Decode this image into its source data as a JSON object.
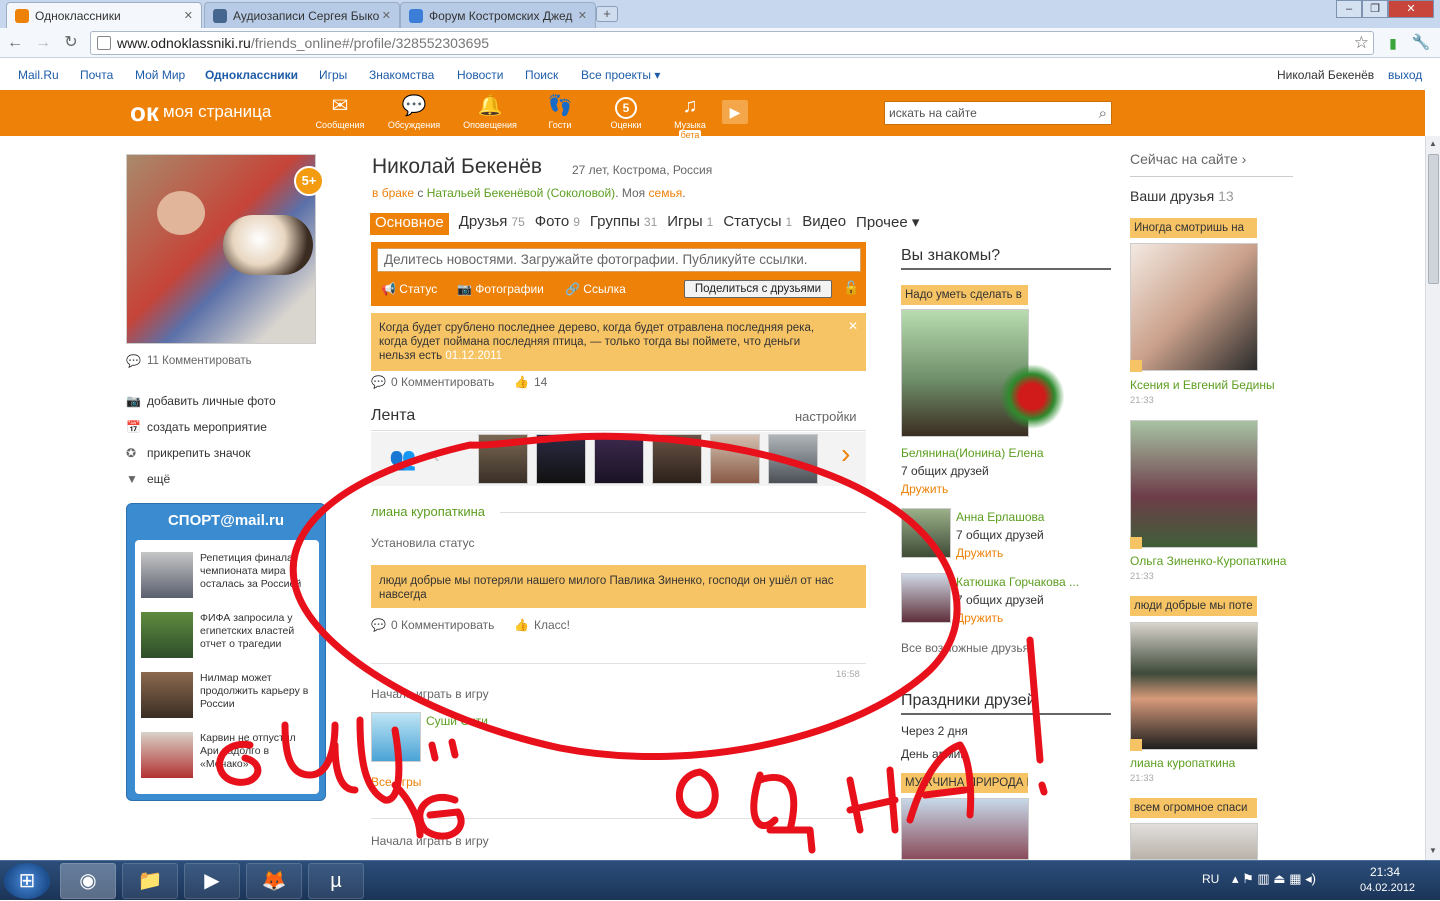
{
  "browser": {
    "tabs": [
      {
        "title": "Одноклассники",
        "active": true,
        "favicon_color": "#ee8208"
      },
      {
        "title": "Аудиозаписи Сергея Быко",
        "active": false,
        "favicon_color": "#45668e"
      },
      {
        "title": "Форум Костромских Джед",
        "active": false,
        "favicon_color": "#3b7dd8"
      }
    ],
    "new_tab": "+",
    "url_host": "www.odnoklassniki.ru",
    "url_path": "/friends_online#/profile/328552303695"
  },
  "mail_nav": {
    "links": [
      "Mail.Ru",
      "Почта",
      "Мой Мир",
      "Одноклассники",
      "Игры",
      "Знакомства",
      "Новости",
      "Поиск",
      "Все проекты"
    ],
    "current": "Одноклассники",
    "user": "Николай Бекенёв",
    "logout": "выход"
  },
  "header": {
    "my_page": "моя страница",
    "nav": [
      {
        "label": "Сообщения",
        "icon": "envelope-icon"
      },
      {
        "label": "Обсуждения",
        "icon": "chat-bubbles-icon"
      },
      {
        "label": "Оповещения",
        "icon": "bell-icon"
      },
      {
        "label": "Гости",
        "icon": "footprints-icon"
      },
      {
        "label": "Оценки",
        "icon": "rating-five-icon",
        "value": "5"
      },
      {
        "label": "Музыка",
        "icon": "music-note-icon",
        "badge": "бета"
      }
    ],
    "search_placeholder": "искать на сайте"
  },
  "left": {
    "avatar_badge": "5+",
    "comments": "11 Комментировать",
    "actions": [
      "добавить личные фото",
      "создать мероприятие",
      "прикрепить значок",
      "ещё"
    ],
    "sport": {
      "title": "СПОРТ@mail.ru",
      "news": [
        "Репетиция финала чемпионата мира осталась за Россией",
        "ФИФА запросила у египетских властей отчет о трагедии",
        "Нилмар может продолжить карьеру в России",
        "Карвин не отпустил Ари надолго в «Монако»"
      ]
    }
  },
  "profile": {
    "name": "Николай Бекенёв",
    "meta": "27 лет, Кострома, Россия",
    "marital_prefix": "в браке",
    "marital_with": "с",
    "spouse": "Натальей Бекенёвой (Соколовой)",
    "family_prefix": ". Моя",
    "family_link": "семья",
    "tabs": [
      {
        "label": "Основное",
        "count": ""
      },
      {
        "label": "Друзья",
        "count": "75"
      },
      {
        "label": "Фото",
        "count": "9"
      },
      {
        "label": "Группы",
        "count": "31"
      },
      {
        "label": "Игры",
        "count": "1"
      },
      {
        "label": "Статусы",
        "count": "1"
      },
      {
        "label": "Видео",
        "count": ""
      },
      {
        "label": "Прочее ▾",
        "count": ""
      }
    ],
    "post_placeholder": "Делитесь новостями. Загружайте фотографии. Публикуйте ссылки.",
    "post_options": [
      "Статус",
      "Фотографии",
      "Ссылка"
    ],
    "share_button": "Поделиться с друзьями",
    "quote_text": "Когда будет срублено последнее дерево, когда будет отравлена последняя река, когда будет поймана последняя птица, — только тогда вы поймете, что деньги нельзя есть",
    "quote_date": "01.12.2011",
    "quote_comments": "0 Комментировать",
    "quote_likes": "14"
  },
  "feed": {
    "title": "Лента",
    "settings": "настройки",
    "item1_author": "лиана куропаткина",
    "item1_action": "Установила статус",
    "item1_status": "люди добрые мы потеряли нашего милого Павлика Зиненко, господи он ушёл от нас навсегда",
    "item1_comments": "0 Комментировать",
    "item1_class": "Класс!",
    "item2_time": "16:58",
    "item2_action": "Начала играть в игру",
    "item2_game": "Суши Сити",
    "item2_all": "Все игры",
    "item3_action": "Начала играть в игру"
  },
  "know": {
    "title": "Вы знакомы?",
    "tag1": "Надо уметь сделать в",
    "p1_name": "Белянина(Ионина) Елена",
    "p1_common": "7 общих друзей",
    "befriend": "Дружить",
    "p2_name": "Анна Ерлашова",
    "p2_common": "7 общих друзей",
    "p3_name": "Катюшка Горчакова ...",
    "p3_common": "7 общих друзей",
    "all_possible": "Все возможные друзья",
    "holidays_title": "Праздники друзей",
    "h1": "Через 2 дня",
    "h2": "День армии",
    "tag2": "МУЖЧИНА ПРИРОДА К"
  },
  "online": {
    "now": "Сейчас на сайте ›",
    "friends_label": "Ваши друзья",
    "friends_count": "13",
    "f1_tag": "Иногда смотришь на",
    "f1_name": "Ксения и Евгений Бедины",
    "f1_time": "21:33",
    "f2_name": "Ольга Зиненко-Куропаткина",
    "f2_time": "21:33",
    "f3_tag": "люди добрые мы поте",
    "f3_name": "лиана куропаткина",
    "f3_time": "21:33",
    "f4_tag": "всем огромное спаси"
  },
  "taskbar": {
    "lang": "RU",
    "time": "21:34",
    "date": "04.02.2012"
  },
  "colors": {
    "ok_orange": "#ee8208",
    "status_yellow": "#f7c465",
    "link_green": "#5b9e1f",
    "mail_blue": "#1e5ca8",
    "scribble_red": "#e8101a"
  },
  "annotation": {
    "words": [
      "ещё",
      "одна!"
    ]
  }
}
